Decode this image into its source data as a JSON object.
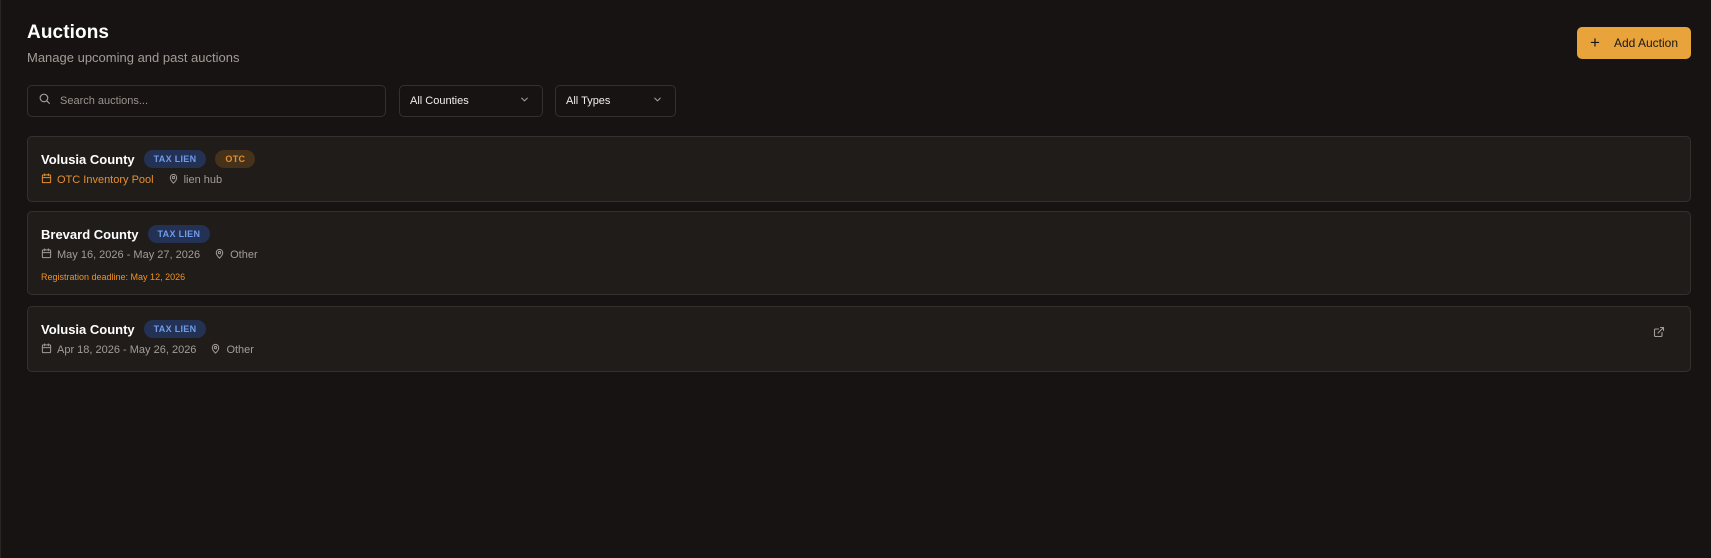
{
  "header": {
    "title": "Auctions",
    "subtitle": "Manage upcoming and past auctions",
    "add_button_label": "Add Auction"
  },
  "filters": {
    "search_placeholder": "Search auctions...",
    "search_value": "",
    "county_select": "All Counties",
    "type_select": "All Types"
  },
  "auctions": [
    {
      "county": "Volusia County",
      "badges": [
        "TAX LIEN",
        "OTC"
      ],
      "date": "OTC Inventory Pool",
      "location": "lien hub"
    },
    {
      "county": "Brevard County",
      "badges": [
        "TAX LIEN"
      ],
      "date": "May 16, 2026 - May 27, 2026",
      "location": "Other",
      "deadline": "Registration deadline: May 12, 2026"
    },
    {
      "county": "Volusia County",
      "badges": [
        "TAX LIEN"
      ],
      "date": "Apr 18, 2026 - May 26, 2026",
      "location": "Other",
      "has_external_link": true
    }
  ],
  "icons": {
    "add": "plus-icon",
    "search": "search-icon",
    "dropdown": "chevron-down-icon",
    "date": "calendar-icon",
    "location": "map-pin-icon",
    "external": "external-link-icon"
  },
  "colors": {
    "background": "#161312",
    "card": "#201c1a",
    "accent": "#e8a33b",
    "tax_lien_badge": "#6f9cec",
    "otc_badge": "#e58f2f",
    "deadline_text": "#f0931f"
  }
}
